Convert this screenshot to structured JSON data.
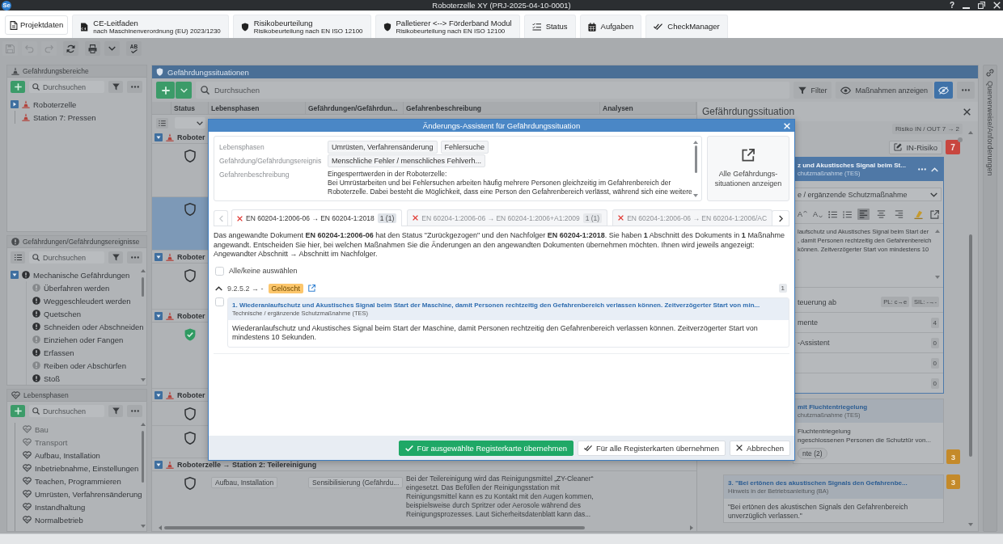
{
  "window": {
    "logo": "Se",
    "title": "Roboterzelle XY (PRJ-2025-04-10-0001)",
    "help": "?"
  },
  "tabs": [
    {
      "kind": "button",
      "label": "Projektdaten"
    },
    {
      "kind": "guide",
      "label": "CE-Leitfaden",
      "sublabel": "nach Maschinenverordnung (EU) 2023/1230"
    },
    {
      "kind": "assessment",
      "label": "Risikobeurteilung",
      "sublabel": "Risikobeurteilung nach EN ISO 12100"
    },
    {
      "kind": "assessment",
      "label": "Palletierer <--> Förderband Modul",
      "sublabel": "Risikobeurteilung nach EN ISO 12100"
    },
    {
      "kind": "status",
      "label": "Status"
    },
    {
      "kind": "tasks",
      "label": "Aufgaben"
    },
    {
      "kind": "checks",
      "label": "CheckManager"
    }
  ],
  "toolbar": [
    {
      "kind": "save",
      "disabled": true
    },
    {
      "kind": "undo",
      "disabled": true
    },
    {
      "kind": "redo",
      "disabled": true
    },
    {
      "kind": "refresh",
      "disabled": false
    },
    {
      "kind": "print",
      "disabled": false
    },
    {
      "kind": "dropdown",
      "disabled": false
    },
    {
      "kind": "spellcheck",
      "label": "AB",
      "disabled": false
    }
  ],
  "hazard_areas": {
    "title": "Gefährdungsbereiche",
    "search": {
      "placeholder": "Durchsuchen"
    },
    "tree": [
      {
        "label": "Roboterzelle",
        "expanded": false,
        "children": [
          {
            "label": "Station 7: Pressen"
          }
        ]
      }
    ]
  },
  "hazards": {
    "title": "Gefährdungen/Gefährdungsereignisse",
    "search": {
      "placeholder": "Durchsuchen"
    },
    "tree": [
      {
        "label": "Mechanische Gefährdungen",
        "expanded": true,
        "children": [
          {
            "label": "Überfahren werden",
            "active": false
          },
          {
            "label": "Weggeschleudert werden",
            "active": true
          },
          {
            "label": "Quetschen",
            "active": true
          },
          {
            "label": "Schneiden oder Abschneiden",
            "active": true
          },
          {
            "label": "Einziehen oder Fangen",
            "active": false
          },
          {
            "label": "Erfassen",
            "active": true
          },
          {
            "label": "Reiben oder Abschürfen",
            "active": false
          },
          {
            "label": "Stoß",
            "active": true
          }
        ]
      }
    ]
  },
  "life_phases": {
    "title": "Lebensphasen",
    "search": {
      "placeholder": "Durchsuchen"
    },
    "items": [
      {
        "label": "Bau",
        "disabled": true
      },
      {
        "label": "Transport",
        "disabled": true
      },
      {
        "label": "Aufbau, Installation",
        "disabled": false
      },
      {
        "label": "Inbetriebnahme, Einstellungen",
        "disabled": false
      },
      {
        "label": "Teachen, Programmieren",
        "disabled": false
      },
      {
        "label": "Umrüsten, Verfahrensänderung",
        "disabled": false
      },
      {
        "label": "Instandhaltung",
        "disabled": false
      },
      {
        "label": "Normalbetrieb",
        "disabled": false
      }
    ]
  },
  "situations": {
    "title": "Gefährdungssituationen",
    "search": {
      "placeholder": "Durchsuchen"
    },
    "filter_button": "Filter",
    "measures_button": "Maßnahmen anzeigen",
    "hide_measures": {
      "on": true
    },
    "columns": [
      "Status",
      "Lebensphasen",
      "Gefährdungen/Gefährdun...",
      "Gefahrenbeschreibung",
      "Analysen"
    ],
    "groups": [
      {
        "label": "Roboter",
        "expanded": true,
        "rows": [
          {
            "done": false,
            "selected": false
          },
          {
            "done": false,
            "selected": true
          }
        ]
      },
      {
        "label": "Roboter",
        "expanded": true,
        "rows": [
          {
            "done": false,
            "selected": false
          }
        ]
      },
      {
        "label": "Roboter",
        "expanded": true,
        "rows": [
          {
            "done": true,
            "selected": false
          }
        ]
      },
      {
        "label": "Roboter",
        "expanded": true,
        "rows": [
          {
            "done": false,
            "selected": false
          },
          {
            "done": false,
            "selected": false
          }
        ]
      },
      {
        "label": "Roboterzelle → Station 2: Teilereinigung",
        "expanded": true,
        "rows": [
          {
            "done": false,
            "selected": false,
            "life_phases": [
              "Aufbau, Installation"
            ],
            "hazards": [
              "Sensibilisierung (Gefährdu..."
            ],
            "description": "Bei der Teilereinigung wird das Reinigungsmittel „ZY-Cleaner“ eingesetzt. Das Befüllen der Reinigungsstation mit Reinigungsmittel kann es zu Kontakt mit den Augen kommen, beispielsweise durch Spritzer oder Aerosole während des Reinigungsprozesses. Laut Sicherheitsdatenblatt kann das..."
          }
        ]
      }
    ]
  },
  "detail": {
    "title": "Gefährdungssituation",
    "risk": "Risiko IN / OUT 7 → 2",
    "in_risk_button": "IN-Risiko",
    "risk_badge": "7",
    "measures": [
      {
        "selected": true,
        "title": "z und Akustisches Signal beim St...",
        "subtitle": "chutzmaßnahme (TES)",
        "type": "e / ergänzende Schutzmaßnahme",
        "editor_tools": [
          {
            "kind": "grow",
            "label": "A"
          },
          {
            "kind": "shrink",
            "label": "A"
          },
          {
            "kind": "bullets"
          },
          {
            "kind": "numbers"
          },
          {
            "kind": "align_left",
            "selected": true
          },
          {
            "kind": "align_center",
            "selected": false
          },
          {
            "kind": "align_right",
            "selected": false
          },
          {
            "kind": "highlight"
          },
          {
            "kind": "open"
          }
        ],
        "editor_lines": [
          "laufschutz und Akustisches Signal beim Start der",
          ", damit Personen rechtzeitig den Gefahrenbereich",
          "können. Zeitverzögerter Start von mindestens 10",
          "."
        ],
        "rows": [
          {
            "label": "teuerung ab",
            "chips": [
              "PL: c→e",
              "SIL: -→-"
            ]
          },
          {
            "label": "mente",
            "count": "4"
          },
          {
            "label": "-Assistent",
            "count": "0"
          },
          {
            "count": "0"
          },
          {
            "count": "0"
          }
        ]
      },
      {
        "selected": false,
        "title": "mit Fluchtentriegelung",
        "subtitle": "chutzmaßnahme (TES)",
        "body_lines": [
          "Fluchtentriegelung",
          "ngeschlossenen Personen die Schutztür von..."
        ],
        "chip": "nte (2)",
        "badge": "3"
      },
      {
        "selected": false,
        "title": "3. \"Bei ertönen des akustischen Signals den Gefahrenbe...",
        "subtitle": "Hinweis in der Betriebsanleitung (BA)",
        "body_lines": [
          "\"Bei ertönen des akustischen Signals den Gefahrenbereich unverzüglich verlassen.\""
        ],
        "badge": "3"
      }
    ]
  },
  "side_tab": "Querverweise/Anforderungen",
  "dialog": {
    "title": "Änderungs-Assistent für Gefährdungssituation",
    "info": [
      {
        "kind": "chips",
        "label": "Lebensphasen",
        "chips": [
          "Umrüsten, Verfahrensänderung",
          "Fehlersuche"
        ]
      },
      {
        "kind": "chips",
        "label": "Gefährdung/Gefährdungsereignis",
        "chips": [
          "Menschliche Fehler / menschliches Fehlverh..."
        ]
      },
      {
        "kind": "text",
        "label": "Gefahrenbeschreibung",
        "lines": [
          "Eingesperrtwerden in der Roboterzelle:",
          "Bei Umrüstarbeiten und bei Fehlersuchen arbeiten häufig mehrere Personen gleichzeitig im Gefahrenbereich der Roboterzelle. Dabei besteht die Möglichkeit, dass eine Person den Gefahrenbereich verlässt, während sich eine weitere"
        ]
      }
    ],
    "show_all_button": "Alle Gefährdungs-situationen anzeigen",
    "prev": {
      "disabled": true
    },
    "next": {
      "disabled": false
    },
    "tabs": [
      {
        "label": "EN 60204-1:2006-06 → EN 60204-1:2018",
        "count": "1 (1)",
        "selected": true
      },
      {
        "label": "EN 60204-1:2006-06 → EN 60204-1:2006+A1:2009",
        "count": "1 (1)",
        "selected": false
      },
      {
        "label": "EN 60204-1:2006-06 → EN 60204-1:2006/AC",
        "selected": false
      }
    ],
    "message": "Das angewandte Dokument **EN 60204-1:2006-06** hat den Status \"Zurückgezogen\" und den Nachfolger **EN 60204-1:2018**. Sie haben **1** Abschnitt des Dokuments in **1** Maßnahme angewandt. Entscheiden Sie hier, bei welchen Maßnahmen Sie die Änderungen an den angewandten Dokumenten übernehmen möchten. Ihnen wird jeweils angezeigt: Angewandter Abschnitt → Abschnitt im Nachfolger.",
    "select_all": {
      "label": "Alle/keine auswählen",
      "checked": false
    },
    "sections": [
      {
        "mapping": "9.2.5.2 → -",
        "status": "Gelöscht",
        "count": "1",
        "expanded": true,
        "measures": [
          {
            "checked": false,
            "title": "1. Wiederanlaufschutz und Akustisches Signal beim Start der Maschine, damit Personen rechtzeitig den Gefahrenbereich verlassen können. Zeitverzögerter Start von min...",
            "subtitle": "Technische / ergänzende Schutzmaßnahme (TES)",
            "text": "Wiederanlaufschutz und Akustisches Signal beim Start der Maschine, damit Personen rechtzeitig den Gefahrenbereich verlassen können. Zeitverzögerter Start von mindestens 10 Sekunden."
          }
        ]
      }
    ],
    "buttons": [
      {
        "kind": "primary",
        "label": "Für ausgewählte Registerkarte übernehmen"
      },
      {
        "kind": "apply_all",
        "label": "Für alle Registerkarten übernehmen"
      },
      {
        "kind": "cancel",
        "label": "Abbrechen"
      }
    ]
  }
}
